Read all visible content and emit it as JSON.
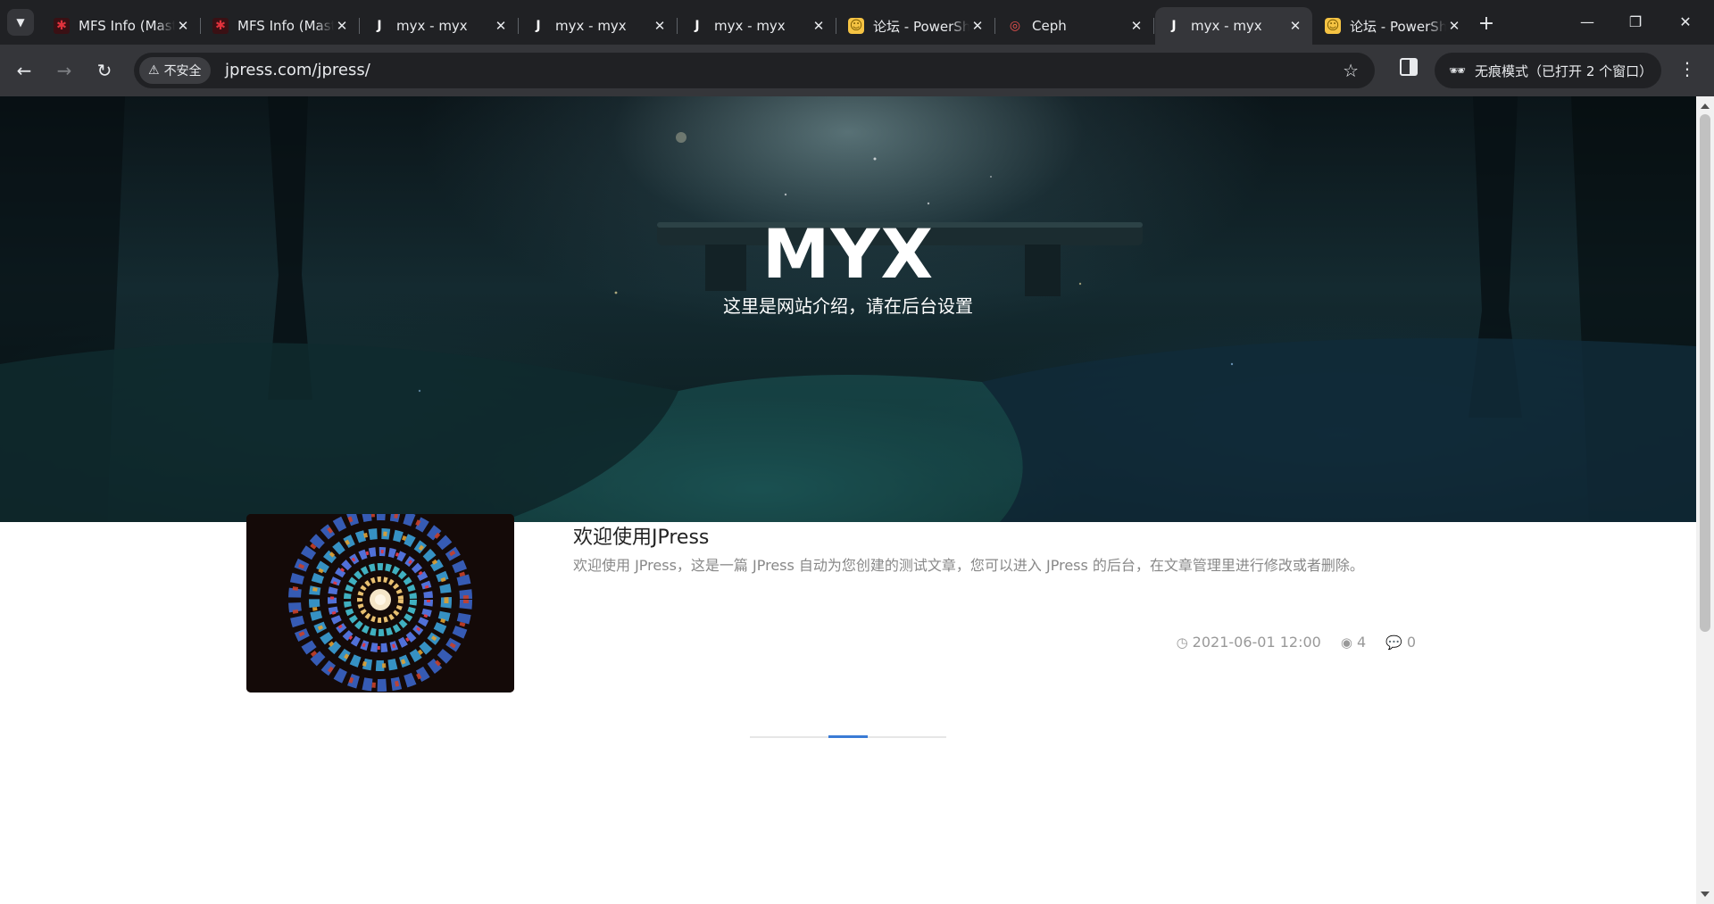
{
  "browser": {
    "tabs": [
      {
        "title": "MFS Info (Master",
        "favicon": "mfs-icon",
        "active": false
      },
      {
        "title": "MFS Info (Master",
        "favicon": "mfs-icon",
        "active": false
      },
      {
        "title": "myx - myx",
        "favicon": "jpress-icon",
        "active": false
      },
      {
        "title": "myx - myx",
        "favicon": "jpress-icon",
        "active": false
      },
      {
        "title": "myx - myx",
        "favicon": "jpress-icon",
        "active": false
      },
      {
        "title": "论坛 - PowerShell",
        "favicon": "forum-icon",
        "active": false
      },
      {
        "title": "Ceph",
        "favicon": "ceph-icon",
        "active": false
      },
      {
        "title": "myx - myx",
        "favicon": "jpress-icon",
        "active": true
      },
      {
        "title": "论坛 - PowerShell",
        "favicon": "forum-icon",
        "active": false
      }
    ],
    "security_label": "不安全",
    "url": "jpress.com/jpress/",
    "incognito_label": "无痕模式（已打开 2 个窗口）"
  },
  "hero": {
    "title": "MYX",
    "subtitle": "这里是网站介绍，请在后台设置"
  },
  "post": {
    "title": "欢迎使用JPress",
    "excerpt": "欢迎使用 JPress，这是一篇 JPress 自动为您创建的测试文章，您可以进入 JPress 的后台，在文章管理里进行修改或者删除。",
    "date": "2021-06-01 12:00",
    "views": "4",
    "comments": "0"
  },
  "colors": {
    "tabstrip": "#202124",
    "toolbar": "#35363a",
    "pager_active": "#3a7bd5"
  }
}
